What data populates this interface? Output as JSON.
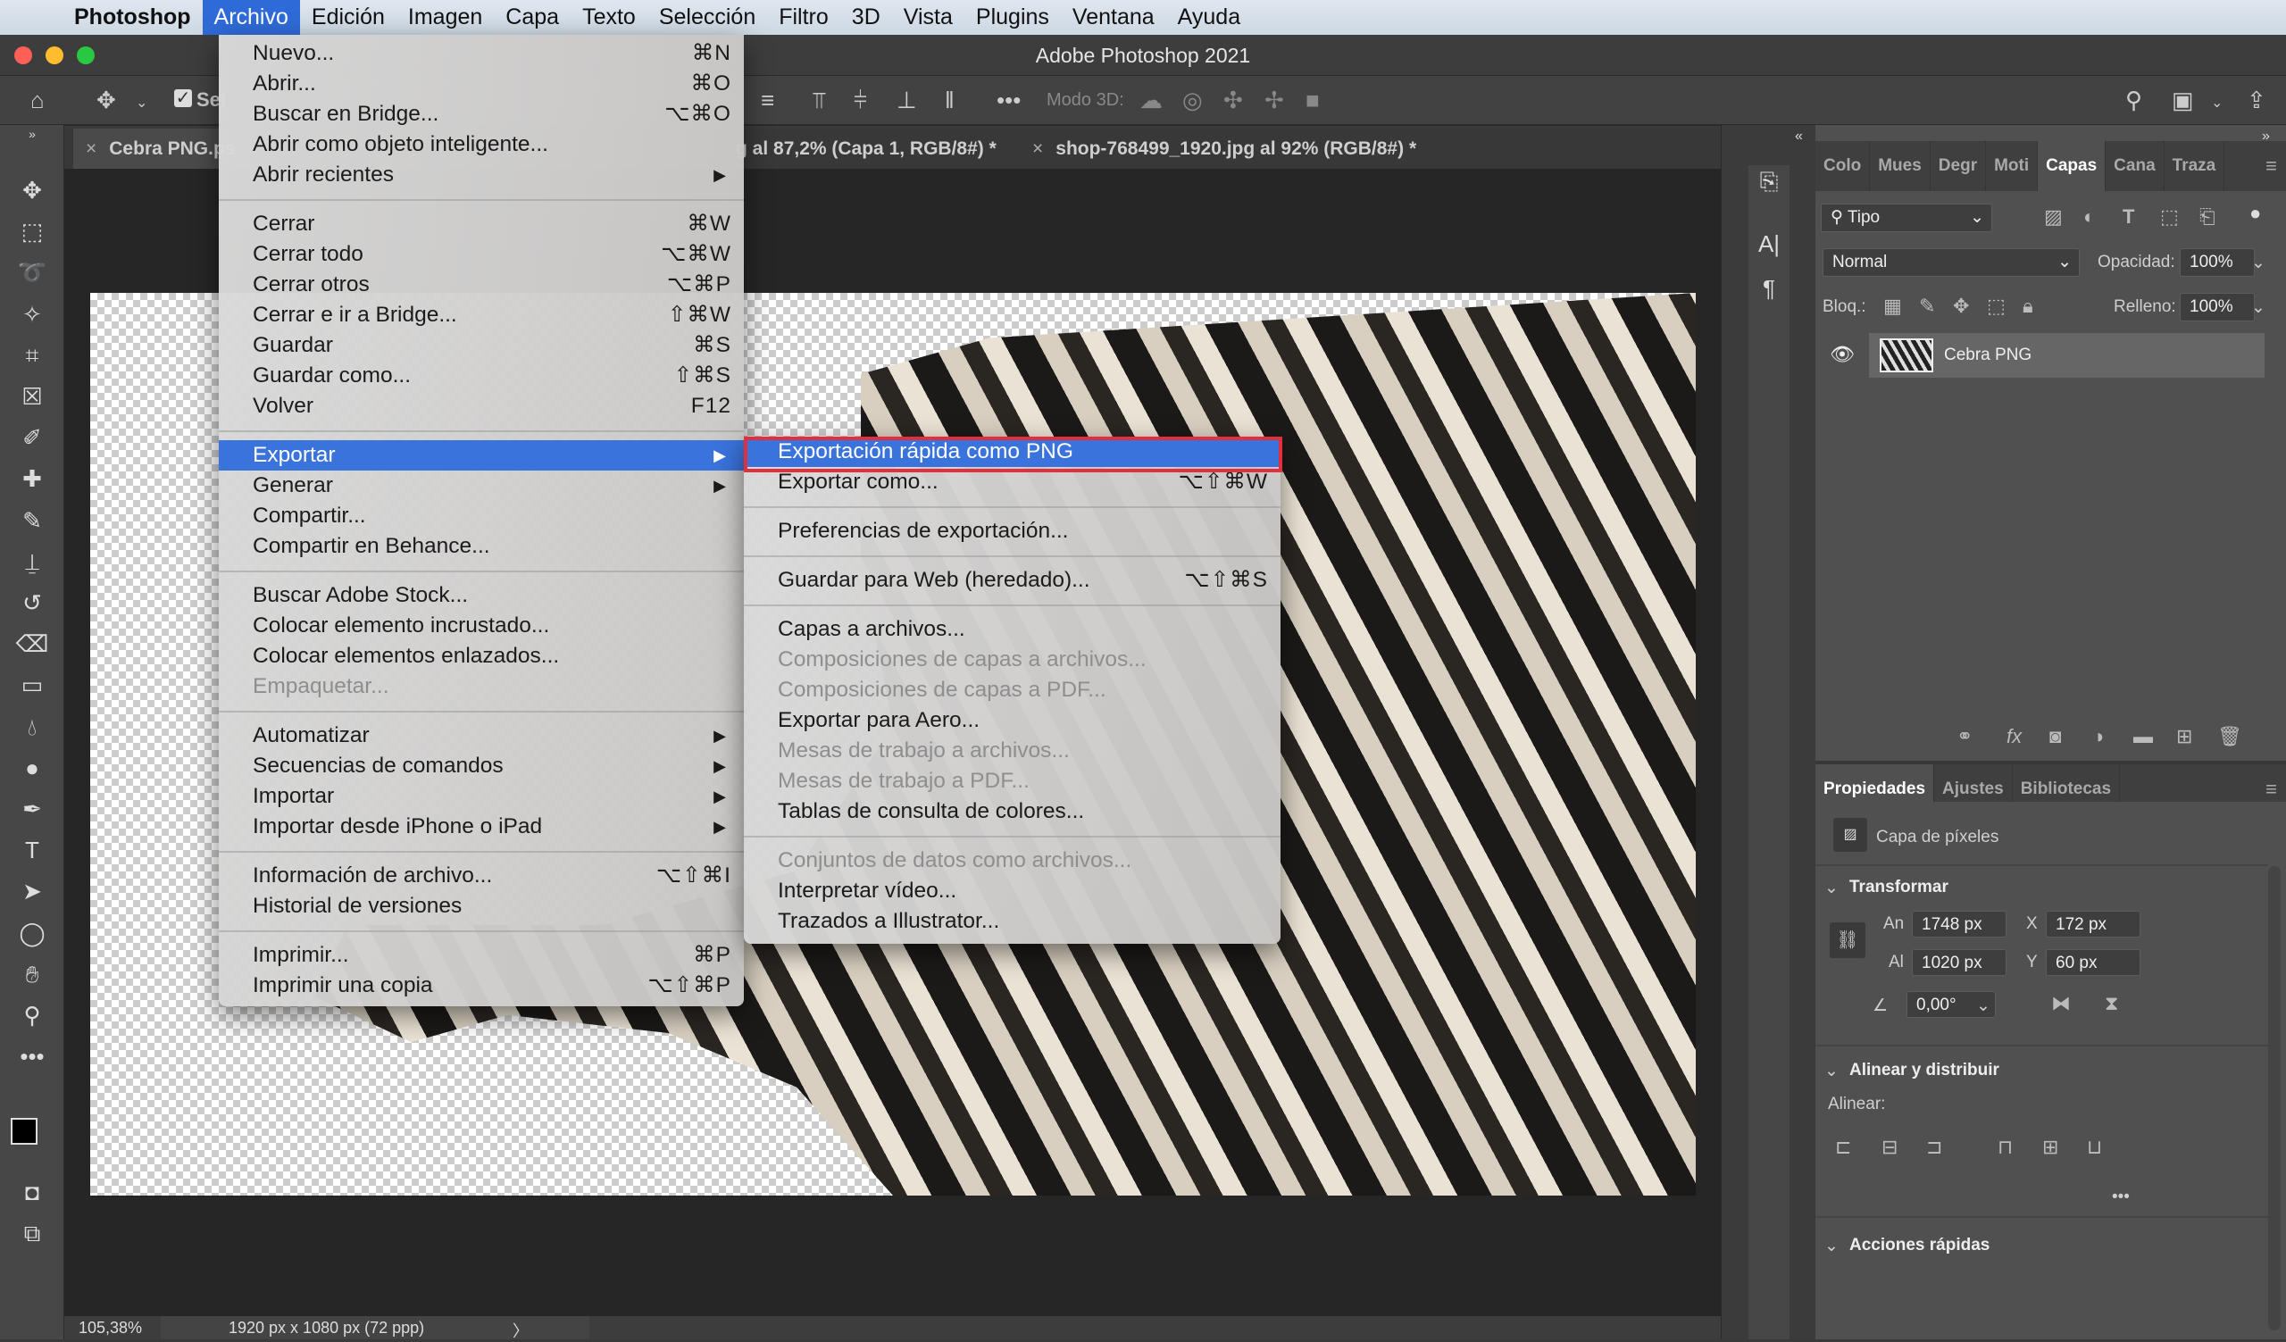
{
  "menubar": {
    "apple_icon": "apple-icon",
    "app": "Photoshop",
    "items": [
      "Archivo",
      "Edición",
      "Imagen",
      "Capa",
      "Texto",
      "Selección",
      "Filtro",
      "3D",
      "Vista",
      "Plugins",
      "Ventana",
      "Ayuda"
    ],
    "active": "Archivo"
  },
  "window": {
    "title": "Adobe Photoshop 2021"
  },
  "options": {
    "auto_select_label": "Sel",
    "mode3d_label": "Modo 3D:"
  },
  "tabs": [
    {
      "label": "Cebra PNG.ps"
    },
    {
      "label": "g al 87,2% (Capa 1, RGB/8#) *"
    },
    {
      "label": "shop-768499_1920.jpg al 92% (RGB/8#) *"
    }
  ],
  "file_menu": [
    {
      "label": "Nuevo...",
      "shortcut": "⌘N"
    },
    {
      "label": "Abrir...",
      "shortcut": "⌘O"
    },
    {
      "label": "Buscar en Bridge...",
      "shortcut": "⌥⌘O"
    },
    {
      "label": "Abrir como objeto inteligente..."
    },
    {
      "label": "Abrir recientes",
      "submenu": true
    },
    {
      "sep": true
    },
    {
      "label": "Cerrar",
      "shortcut": "⌘W"
    },
    {
      "label": "Cerrar todo",
      "shortcut": "⌥⌘W"
    },
    {
      "label": "Cerrar otros",
      "shortcut": "⌥⌘P"
    },
    {
      "label": "Cerrar e ir a Bridge...",
      "shortcut": "⇧⌘W"
    },
    {
      "label": "Guardar",
      "shortcut": "⌘S"
    },
    {
      "label": "Guardar como...",
      "shortcut": "⇧⌘S"
    },
    {
      "label": "Volver",
      "shortcut": "F12"
    },
    {
      "sep": true
    },
    {
      "label": "Exportar",
      "submenu": true,
      "highlighted": true
    },
    {
      "label": "Generar",
      "submenu": true
    },
    {
      "label": "Compartir..."
    },
    {
      "label": "Compartir en Behance..."
    },
    {
      "sep": true
    },
    {
      "label": "Buscar Adobe Stock..."
    },
    {
      "label": "Colocar elemento incrustado..."
    },
    {
      "label": "Colocar elementos enlazados..."
    },
    {
      "label": "Empaquetar...",
      "disabled": true
    },
    {
      "sep": true
    },
    {
      "label": "Automatizar",
      "submenu": true
    },
    {
      "label": "Secuencias de comandos",
      "submenu": true
    },
    {
      "label": "Importar",
      "submenu": true
    },
    {
      "label": "Importar desde iPhone o iPad",
      "submenu": true
    },
    {
      "sep": true
    },
    {
      "label": "Información de archivo...",
      "shortcut": "⌥⇧⌘I"
    },
    {
      "label": "Historial de versiones"
    },
    {
      "sep": true
    },
    {
      "label": "Imprimir...",
      "shortcut": "⌘P"
    },
    {
      "label": "Imprimir una copia",
      "shortcut": "⌥⇧⌘P"
    }
  ],
  "export_submenu": [
    {
      "label": "Exportación rápida como PNG",
      "highlighted": true
    },
    {
      "label": "Exportar como...",
      "shortcut": "⌥⇧⌘W"
    },
    {
      "sep": true
    },
    {
      "label": "Preferencias de exportación..."
    },
    {
      "sep": true
    },
    {
      "label": "Guardar para Web (heredado)...",
      "shortcut": "⌥⇧⌘S"
    },
    {
      "sep": true
    },
    {
      "label": "Capas a archivos..."
    },
    {
      "label": "Composiciones de capas a archivos...",
      "disabled": true
    },
    {
      "label": "Composiciones de capas a PDF...",
      "disabled": true
    },
    {
      "label": "Exportar para Aero..."
    },
    {
      "label": "Mesas de trabajo a archivos...",
      "disabled": true
    },
    {
      "label": "Mesas de trabajo a PDF...",
      "disabled": true
    },
    {
      "label": "Tablas de consulta de colores..."
    },
    {
      "sep": true
    },
    {
      "label": "Conjuntos de datos como archivos...",
      "disabled": true
    },
    {
      "label": "Interpretar vídeo..."
    },
    {
      "label": "Trazados a Illustrator..."
    }
  ],
  "layers_panel": {
    "tabs": [
      "Colo",
      "Mues",
      "Degr",
      "Moti",
      "Capas",
      "Cana",
      "Traza"
    ],
    "active_tab": "Capas",
    "filter": "Tipo",
    "blend_mode": "Normal",
    "opacity_label": "Opacidad:",
    "opacity": "100%",
    "lock_label": "Bloq.:",
    "fill_label": "Relleno:",
    "fill": "100%",
    "layers": [
      {
        "name": "Cebra PNG",
        "visible": true
      }
    ]
  },
  "properties_panel": {
    "tabs": [
      "Propiedades",
      "Ajustes",
      "Bibliotecas"
    ],
    "active_tab": "Propiedades",
    "layer_type": "Capa de píxeles",
    "transform": {
      "title": "Transformar",
      "w_label": "An",
      "w": "1748 px",
      "h_label": "Al",
      "h": "1020 px",
      "x_label": "X",
      "x": "172 px",
      "y_label": "Y",
      "y": "60 px",
      "angle": "0,00°"
    },
    "align": {
      "title": "Alinear y distribuir",
      "label": "Alinear:",
      "more": "•••"
    },
    "quick_actions": {
      "title": "Acciones rápidas"
    }
  },
  "status": {
    "zoom": "105,38%",
    "doc_info": "1920 px x 1080 px (72 ppp)",
    "arrow": "〉"
  },
  "colors": {
    "menu_highlight": "#3a73dc",
    "callout_border": "#e0303d",
    "panel_bg": "#505050",
    "canvas_bg": "#262626"
  }
}
